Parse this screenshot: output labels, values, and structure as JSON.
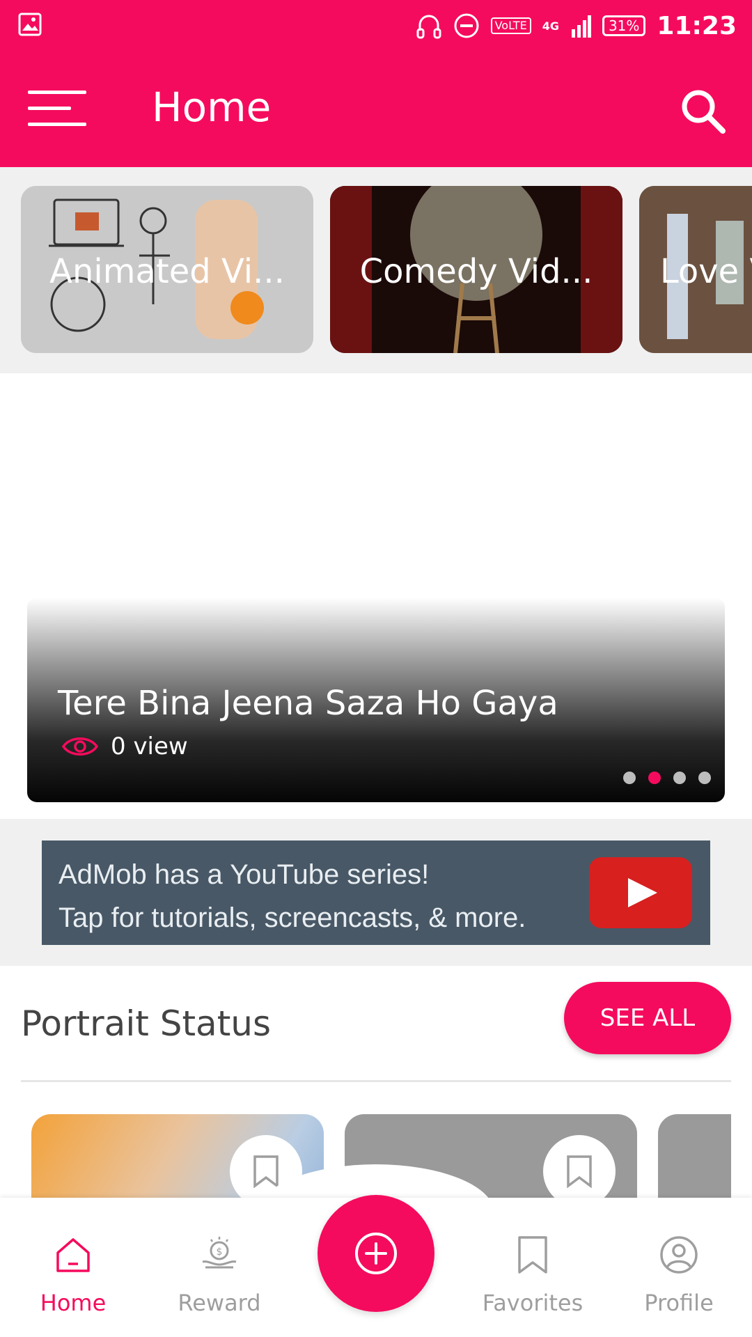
{
  "status_bar": {
    "network": "4G",
    "volte": "VoLTE",
    "battery": "31%",
    "time": "11:23"
  },
  "app_bar": {
    "title": "Home"
  },
  "categories": [
    {
      "label": "Animated Vi..."
    },
    {
      "label": "Comedy Vid..."
    },
    {
      "label": "Love V"
    }
  ],
  "slider": {
    "title": "Tere Bina Jeena Saza Ho Gaya",
    "views": "0 view",
    "dots_total": 4,
    "active_dot": 2
  },
  "ad": {
    "line1": "AdMob has a YouTube series!",
    "line2": "Tap for tutorials, screencasts, & more."
  },
  "portrait_section": {
    "title": "Portrait Status",
    "see_all": "SEE ALL"
  },
  "bottom_nav": {
    "items": [
      {
        "label": "Home",
        "icon": "home-icon",
        "active": true
      },
      {
        "label": "Reward",
        "icon": "reward-icon",
        "active": false
      },
      {
        "label": "Favorites",
        "icon": "bookmark-icon",
        "active": false
      },
      {
        "label": "Profile",
        "icon": "profile-icon",
        "active": false
      }
    ],
    "fab_icon": "add-circle-icon"
  },
  "colors": {
    "accent": "#f50b5d",
    "inactive": "#9e9e9e",
    "ad_bg": "#485866"
  }
}
